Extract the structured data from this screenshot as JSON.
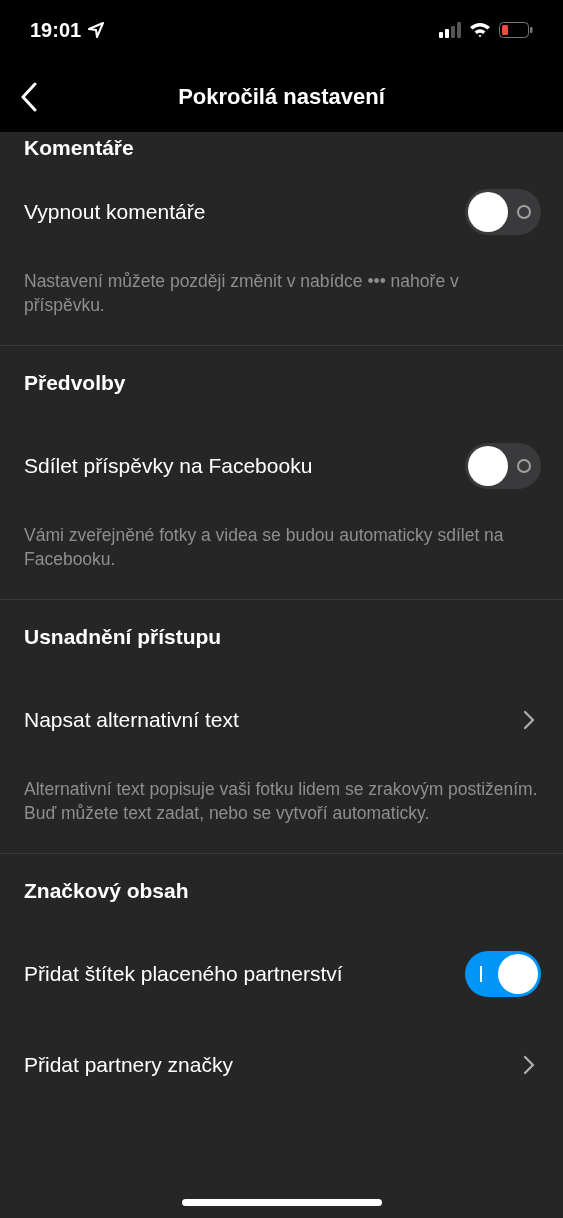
{
  "status_bar": {
    "time": "19:01"
  },
  "header": {
    "title": "Pokročilá nastavení"
  },
  "sections": [
    {
      "heading": "Komentáře",
      "rows": [
        {
          "kind": "toggle",
          "label": "Vypnout komentáře",
          "on": false
        }
      ],
      "description": "Nastavení můžete později změnit v nabídce ••• nahoře v příspěvku."
    },
    {
      "heading": "Předvolby",
      "rows": [
        {
          "kind": "toggle",
          "label": "Sdílet příspěvky na Facebooku",
          "on": false
        }
      ],
      "description": "Vámi zveřejněné fotky a videa se budou automaticky sdílet na Facebooku."
    },
    {
      "heading": "Usnadnění přístupu",
      "rows": [
        {
          "kind": "link",
          "label": "Napsat alternativní text"
        }
      ],
      "description": "Alternativní text popisuje vaši fotku lidem se zrakovým postižením. Buď můžete text zadat, nebo se vytvoří automaticky."
    },
    {
      "heading": "Značkový obsah",
      "rows": [
        {
          "kind": "toggle",
          "label": "Přidat štítek placeného partnerství",
          "on": true
        },
        {
          "kind": "link",
          "label": "Přidat partnery značky"
        }
      ]
    }
  ]
}
